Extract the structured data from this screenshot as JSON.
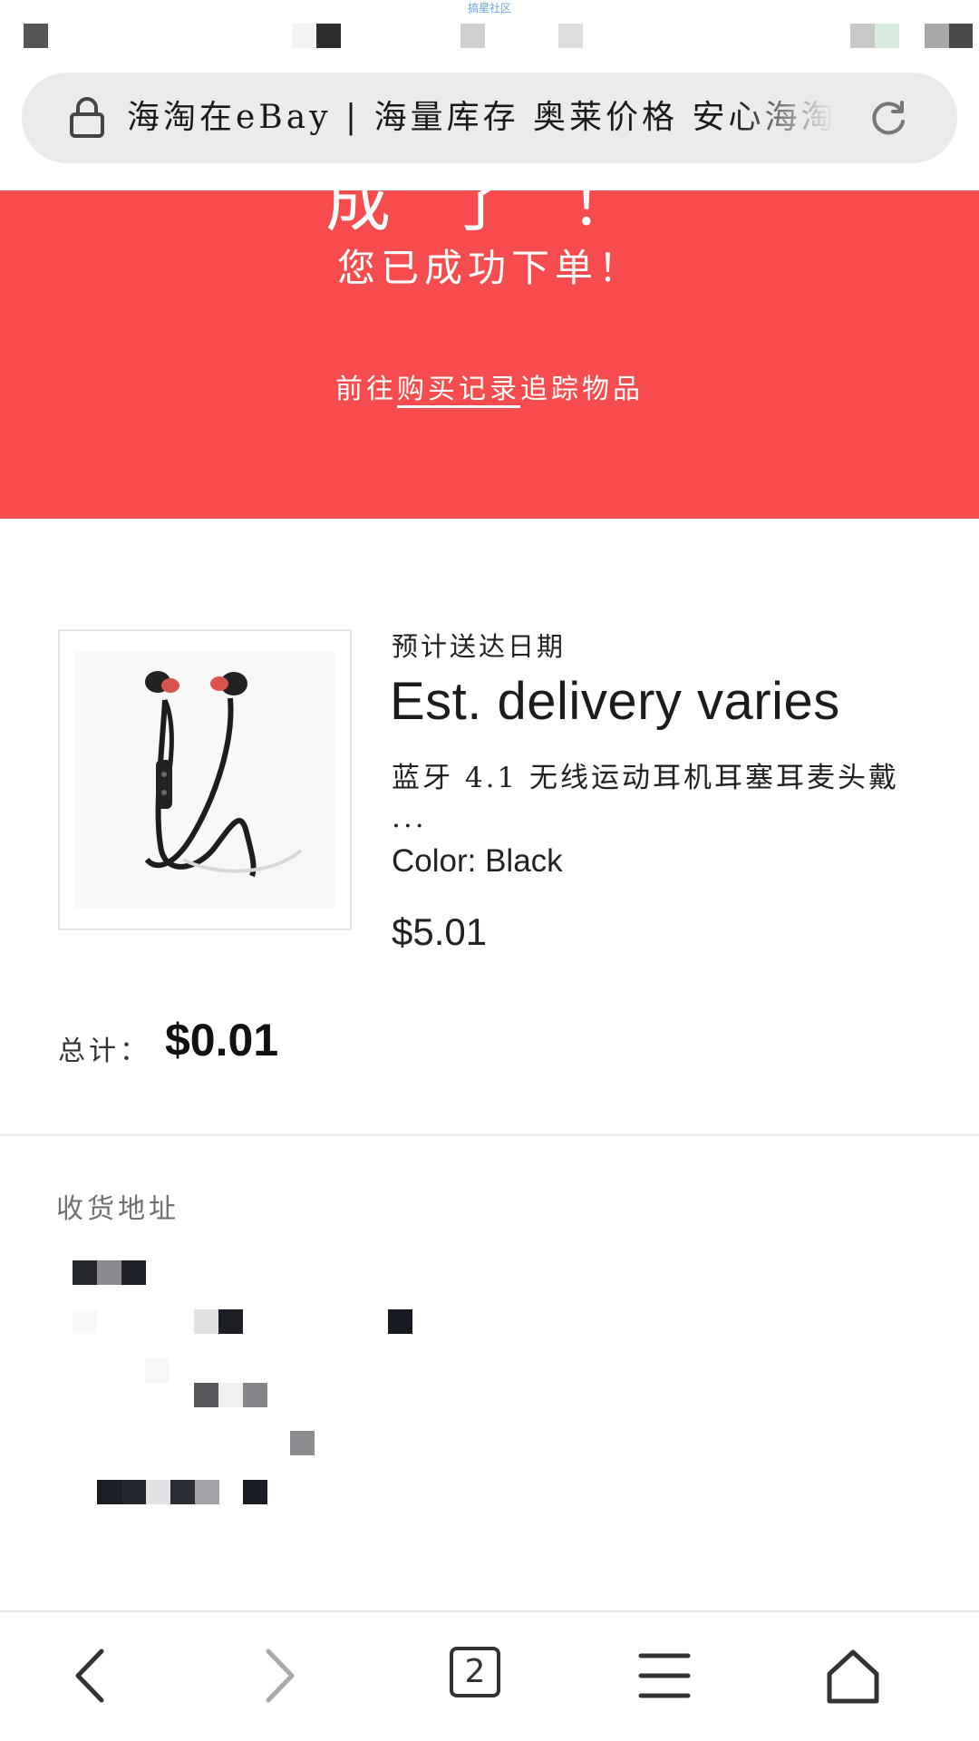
{
  "status_bar": {
    "watermark": "搞星社区"
  },
  "browser": {
    "url_title": "海淘在eBay | 海量库存 奥莱价格 安心海淘",
    "tab_count": "2"
  },
  "banner": {
    "partial_heading": "成 了 ！",
    "title": "您已成功下单！",
    "link_prefix": "前往",
    "link_text": "购买记录",
    "link_suffix": "追踪物品"
  },
  "order": {
    "est_label": "预计送达日期",
    "est_value": "Est. delivery varies",
    "item_title": "蓝牙 4.1 无线运动耳机耳塞耳麦头戴 ...",
    "item_color": "Color: Black",
    "item_price": "$5.01",
    "total_label": "总计：",
    "total_value": "$0.01"
  },
  "shipping": {
    "label": "收货地址"
  },
  "colors": {
    "banner": "#f64c4d",
    "url_bar": "#ebebeb"
  }
}
